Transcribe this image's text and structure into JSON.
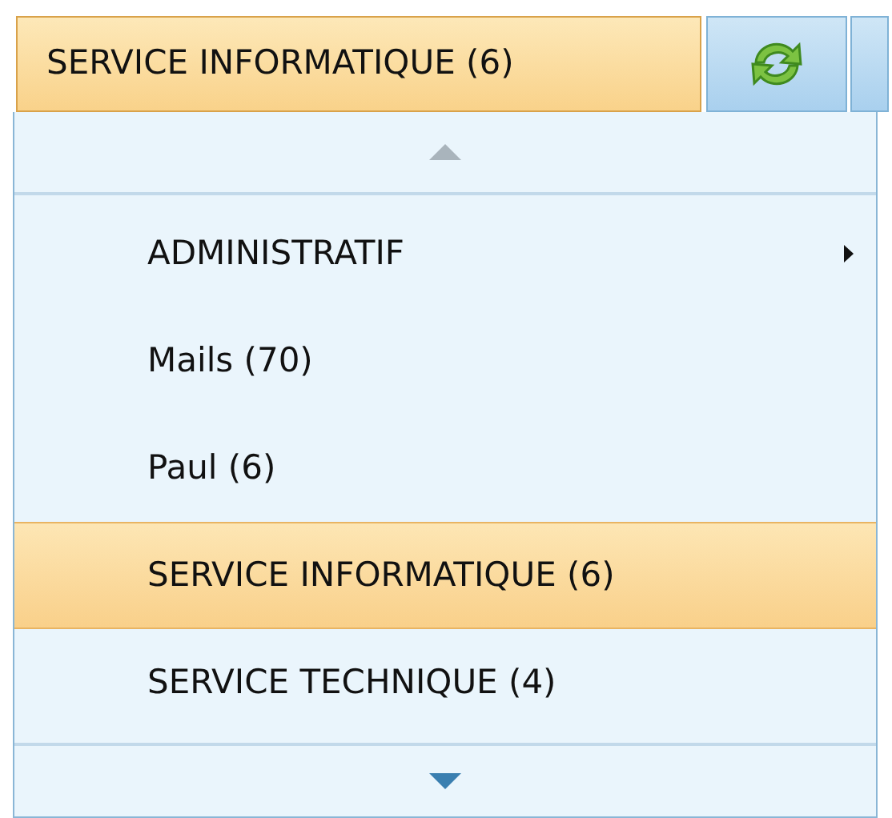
{
  "header": {
    "label": "SERVICE INFORMATIQUE (6)"
  },
  "menu": {
    "scroll_up": {
      "enabled": false
    },
    "scroll_down": {
      "enabled": true
    },
    "items": [
      {
        "label": "ADMINISTRATIF",
        "has_submenu": true,
        "selected": false
      },
      {
        "label": "Mails (70)",
        "has_submenu": false,
        "selected": false
      },
      {
        "label": "Paul (6)",
        "has_submenu": false,
        "selected": false
      },
      {
        "label": "SERVICE INFORMATIQUE (6)",
        "has_submenu": false,
        "selected": true
      },
      {
        "label": "SERVICE TECHNIQUE (4)",
        "has_submenu": false,
        "selected": false
      }
    ]
  }
}
